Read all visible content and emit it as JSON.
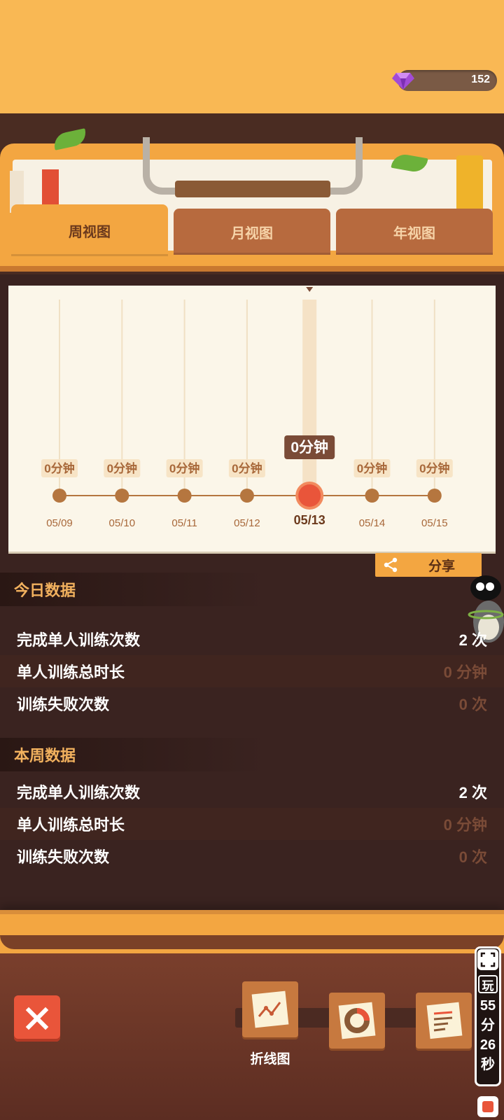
{
  "header": {
    "gem_count": "152"
  },
  "tabs": [
    {
      "label": "周视图",
      "active": true
    },
    {
      "label": "月视图",
      "active": false
    },
    {
      "label": "年视图",
      "active": false
    }
  ],
  "chart_data": {
    "type": "line",
    "categories": [
      "05/09",
      "05/10",
      "05/11",
      "05/12",
      "05/13",
      "05/14",
      "05/15"
    ],
    "value_labels": [
      "0分钟",
      "0分钟",
      "0分钟",
      "0分钟",
      "0分钟",
      "0分钟",
      "0分钟"
    ],
    "values": [
      0,
      0,
      0,
      0,
      0,
      0,
      0
    ],
    "selected_index": 4
  },
  "share": {
    "label": "分享"
  },
  "today": {
    "title": "今日数据",
    "rows": [
      {
        "label": "完成单人训练次数",
        "value": "2 次"
      },
      {
        "label": "单人训练总时长",
        "value": "0 分钟"
      },
      {
        "label": "训练失败次数",
        "value": "0 次"
      }
    ]
  },
  "week": {
    "title": "本周数据",
    "rows": [
      {
        "label": "完成单人训练次数",
        "value": "2 次"
      },
      {
        "label": "单人训练总时长",
        "value": "0 分钟"
      },
      {
        "label": "训练失败次数",
        "value": "0 次"
      }
    ]
  },
  "toolbar": {
    "line_chart_label": "折线图"
  },
  "timer": {
    "badge": "玩",
    "time": "55分26秒"
  },
  "colors": {
    "accent": "#f3a641",
    "selected_point": "#e9553a",
    "point": "#b5763f"
  }
}
